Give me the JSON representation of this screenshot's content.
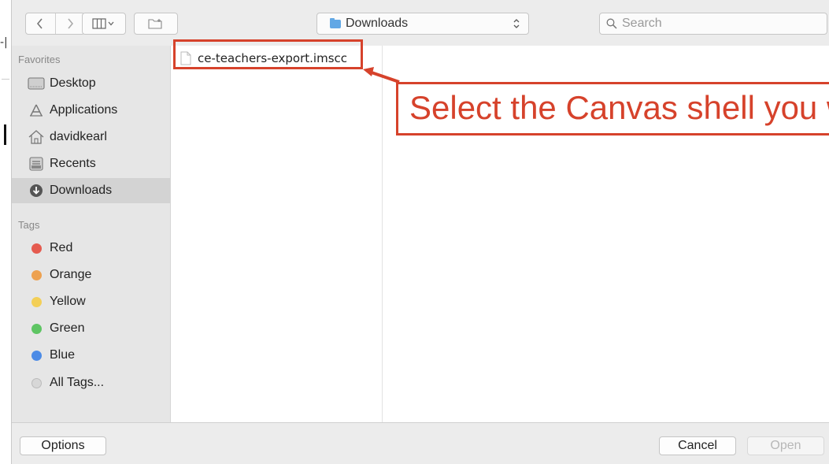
{
  "toolbar": {
    "location_label": "Downloads",
    "search_placeholder": "Search"
  },
  "sidebar": {
    "favorites_header": "Favorites",
    "favorites": [
      {
        "label": "Desktop",
        "icon": "desktop-icon"
      },
      {
        "label": "Applications",
        "icon": "applications-icon"
      },
      {
        "label": "davidkearl",
        "icon": "home-icon"
      },
      {
        "label": "Recents",
        "icon": "recents-icon"
      },
      {
        "label": "Downloads",
        "icon": "downloads-icon",
        "selected": true
      }
    ],
    "tags_header": "Tags",
    "tags": [
      {
        "label": "Red",
        "color": "#e55b4f"
      },
      {
        "label": "Orange",
        "color": "#eda150"
      },
      {
        "label": "Yellow",
        "color": "#f3cf57"
      },
      {
        "label": "Green",
        "color": "#5ec563"
      },
      {
        "label": "Blue",
        "color": "#4c8be6"
      },
      {
        "label": "All Tags...",
        "color": "#d7d7d7"
      }
    ]
  },
  "files": [
    {
      "name": "ce-teachers-export.imscc"
    }
  ],
  "annotation": {
    "text": "Select the Canvas shell you w",
    "color": "#d6422b"
  },
  "bottom": {
    "options_label": "Options",
    "cancel_label": "Cancel",
    "open_label": "Open"
  }
}
